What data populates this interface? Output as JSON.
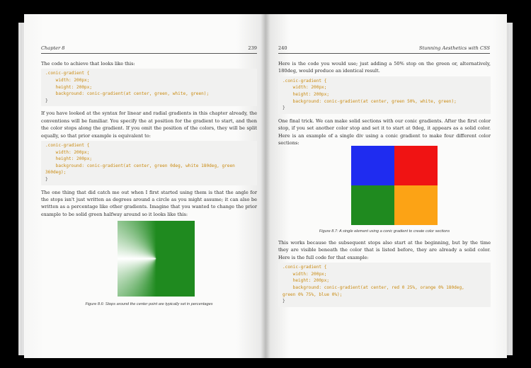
{
  "left_page": {
    "chapter": "Chapter 8",
    "page_number": "239",
    "p1": "The code to achieve that looks like this:",
    "code1": [
      ".conic-gradient {",
      "    width: 200px;",
      "    height: 200px;",
      "    background: conic-gradient(at center, green, white, green);",
      "}"
    ],
    "p2": "If you have looked at the syntax for linear and radial gradients in this chapter already, the conventions will be familiar. You specify the at position for the gradient to start, and then the color stops along the gradient. If you omit the position of the colors, they will be split equally, so that prior example is equivalent to:",
    "code2": [
      ".conic-gradient {",
      "    width: 200px;",
      "    height: 200px;",
      "    background: conic-gradient(at center, green 0deg, white 180deg, green",
      "360deg);",
      "}"
    ],
    "p3": "The one thing that did catch me out when I first started using them is that the angle for the stops isn't just written as degrees around a circle as you might assume; it can also be written as a percentage like other gradients. Imagine that you wanted to change the prior example to be solid green halfway around so it looks like this:",
    "figure_caption": "Figure 8.6: Stops around the center point are typically set in percentages"
  },
  "right_page": {
    "page_number": "240",
    "running_title": "Stunning Aesthetics with CSS",
    "p1": "Here is the code you would use; just adding a 50% stop on the green or, alternatively, 180deg, would produce an identical result.",
    "code1": [
      ".conic-gradient {",
      "    width: 200px;",
      "    height: 200px;",
      "    background: conic-gradient(at center, green 50%, white, green);",
      "}"
    ],
    "p2": "One final trick. We can make solid sections with our conic gradients. After the first color stop, if you set another color stop and set it to start at 0deg, it appears as a solid color. Here is an example of a single div using a conic gradient to make four different color sections:",
    "figure_caption": "Figure 8.7: A single element using a conic gradient to create color sections",
    "p3": "This works because the subsequent stops also start at the beginning, but by the time they are visible beneath the color that is listed before, they are already a solid color. Here is the full code for that example:",
    "code2": [
      ".conic-gradient {",
      "    width: 200px;",
      "    height: 200px;",
      "    background: conic-gradient(at center, red 0 25%, orange 0% 180deg,",
      "green 0% 75%, blue 0%);",
      "}"
    ]
  },
  "colors": {
    "green": "#1f8a1f",
    "blue": "#1f2cf0",
    "red": "#f01313",
    "orange": "#fca315",
    "code_keyword": "#c98a10"
  }
}
